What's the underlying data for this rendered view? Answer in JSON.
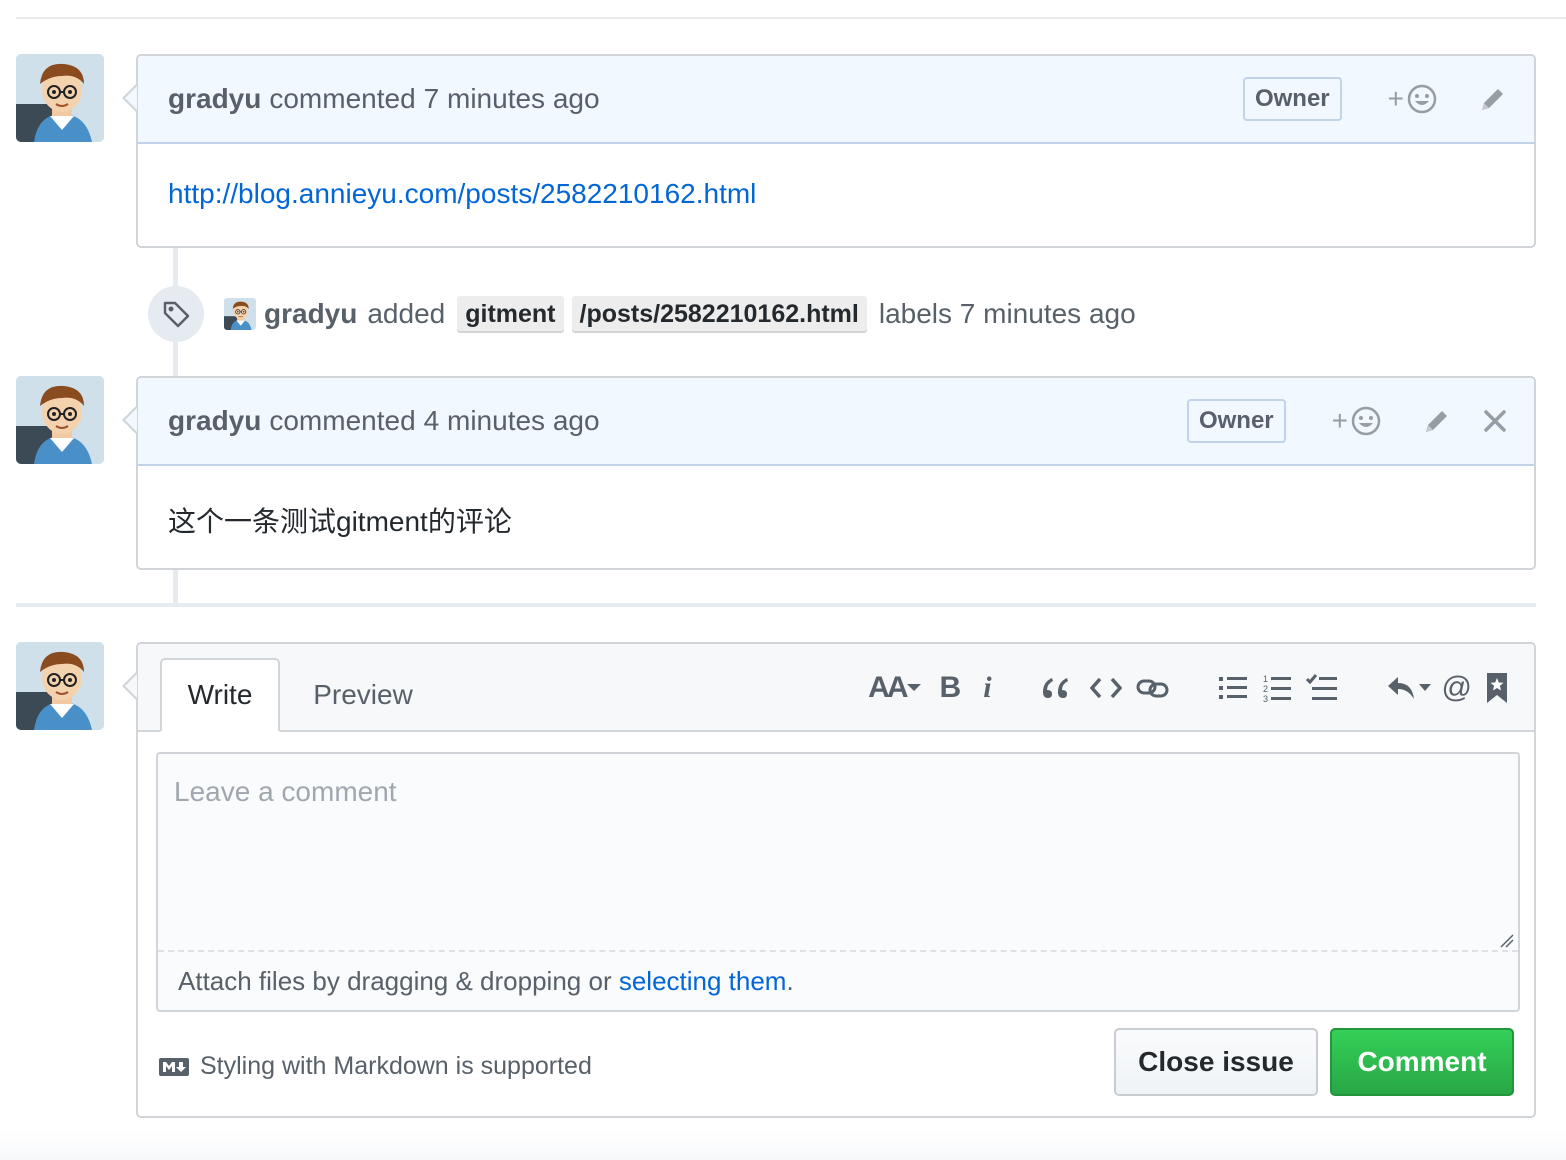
{
  "comments": [
    {
      "author": "gradyu",
      "action": "commented",
      "time": "7 minutes ago",
      "owner_label": "Owner",
      "reaction": "+",
      "body_link": "http://blog.annieyu.com/posts/2582210162.html"
    },
    {
      "author": "gradyu",
      "action": "commented",
      "time": "4 minutes ago",
      "owner_label": "Owner",
      "reaction": "+",
      "body_text": "这个一条测试gitment的评论"
    }
  ],
  "event": {
    "author": "gradyu",
    "action": "added",
    "labels": [
      "gitment",
      "/posts/2582210162.html"
    ],
    "tail": "labels 7 minutes ago"
  },
  "new_comment": {
    "tabs": [
      "Write",
      "Preview"
    ],
    "toolbar": {
      "heading": "AA",
      "bold": "B",
      "italic": "i",
      "mention": "@"
    },
    "placeholder": "Leave a comment",
    "attach_prefix": "Attach files by dragging & dropping or ",
    "attach_link": "selecting them",
    "attach_suffix": ".",
    "markdown_note": "Styling with Markdown is supported",
    "close_button": "Close issue",
    "comment_button": "Comment"
  },
  "colors": {
    "link": "#0366d6",
    "comment_green": "#28a745",
    "header_blue": "#f1f8ff"
  },
  "icons": [
    "tag-icon",
    "smiley-icon",
    "pencil-icon",
    "close-icon",
    "quote-icon",
    "code-icon",
    "link-icon",
    "unordered-list-icon",
    "ordered-list-icon",
    "task-list-icon",
    "reply-icon",
    "bookmark-icon",
    "markdown-icon"
  ]
}
